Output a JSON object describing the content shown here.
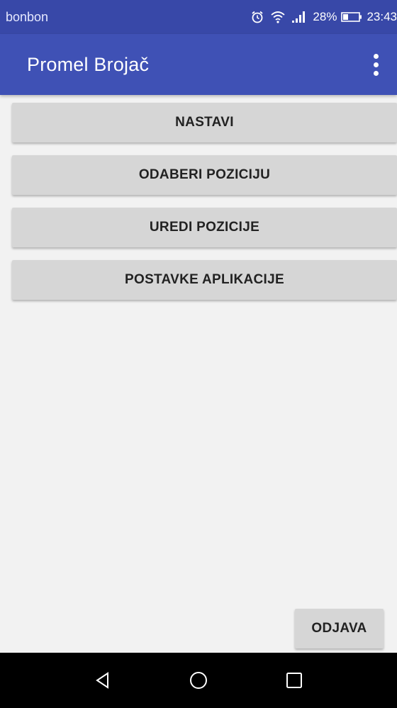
{
  "status_bar": {
    "carrier": "bonbon",
    "battery_percent": "28%",
    "time": "23:43",
    "icons": [
      "alarm-icon",
      "wifi-icon",
      "signal-icon",
      "battery-icon"
    ]
  },
  "app_bar": {
    "title": "Promel Brojač",
    "overflow_icon": "more-vert-icon",
    "color": "#3f51b5"
  },
  "menu": {
    "buttons": [
      {
        "label": "NASTAVI"
      },
      {
        "label": "ODABERI POZICIJU"
      },
      {
        "label": "UREDI POZICIJE"
      },
      {
        "label": "POSTAVKE APLIKACIJE"
      }
    ]
  },
  "logout": {
    "label": "ODJAVA"
  },
  "nav_bar": {
    "icons": [
      "back-icon",
      "home-icon",
      "recents-icon"
    ]
  },
  "colors": {
    "primary": "#3f51b5",
    "primary_dark": "#3848a8",
    "background": "#f2f2f2",
    "button": "#d6d6d6"
  }
}
